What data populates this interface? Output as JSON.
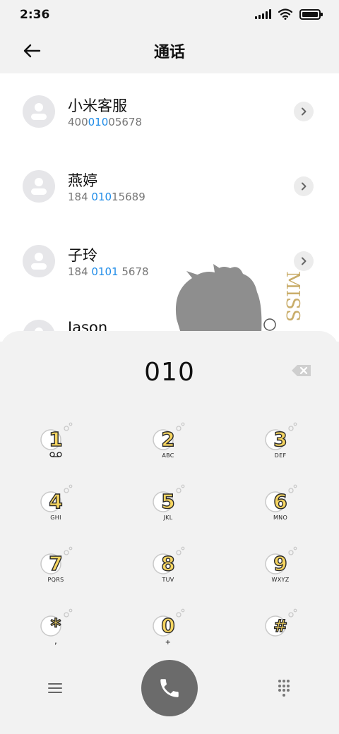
{
  "status_bar": {
    "time": "2:36"
  },
  "header": {
    "title": "通话"
  },
  "contacts": [
    {
      "name": "小米客服",
      "number": [
        {
          "text": "400",
          "hl": false
        },
        {
          "text": "010",
          "hl": true
        },
        {
          "text": "05678",
          "hl": false
        }
      ]
    },
    {
      "name": "燕婷",
      "number": [
        {
          "text": "184 ",
          "hl": false
        },
        {
          "text": "010",
          "hl": true
        },
        {
          "text": "15689",
          "hl": false
        }
      ]
    },
    {
      "name": "子玲",
      "number": [
        {
          "text": "184 ",
          "hl": false
        },
        {
          "text": "0101",
          "hl": true
        },
        {
          "text": " 5678",
          "hl": false
        }
      ]
    },
    {
      "name": "Jason",
      "number": []
    }
  ],
  "decoration": {
    "watermark_text": "MISS"
  },
  "dialer": {
    "input": "010",
    "keys": [
      {
        "digit": "1",
        "sub": "voicemail-icon"
      },
      {
        "digit": "2",
        "sub": "ABC"
      },
      {
        "digit": "3",
        "sub": "DEF"
      },
      {
        "digit": "4",
        "sub": "GHI"
      },
      {
        "digit": "5",
        "sub": "JKL"
      },
      {
        "digit": "6",
        "sub": "MNO"
      },
      {
        "digit": "7",
        "sub": "PQRS"
      },
      {
        "digit": "8",
        "sub": "TUV"
      },
      {
        "digit": "9",
        "sub": "WXYZ"
      },
      {
        "digit": "*",
        "sub": ","
      },
      {
        "digit": "0",
        "sub": "+"
      },
      {
        "digit": "#",
        "sub": ""
      }
    ]
  },
  "colors": {
    "highlight": "#1f8ce8",
    "key_fill": "#f6d560",
    "call_button": "#6b6b6b"
  }
}
